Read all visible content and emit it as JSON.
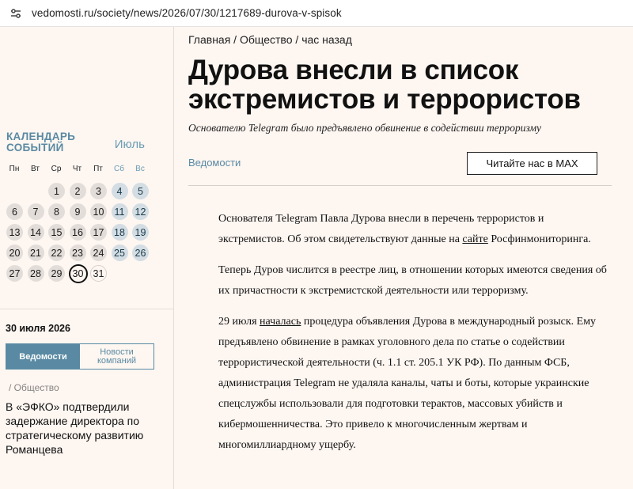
{
  "browser": {
    "url": "vedomosti.ru/society/news/2026/07/30/1217689-durova-v-spisok"
  },
  "breadcrumb": {
    "home": "Главная",
    "sep1": " / ",
    "section": "Общество",
    "sep2": " / ",
    "time": "час назад"
  },
  "article": {
    "headline": "Дурова внесли в список экстремистов и террористов",
    "lead": "Основателю Telegram было предъявлено обвинение в содействии терроризму",
    "source": "Ведомости",
    "max_button": "Читайте нас в MAX",
    "p1_before": "Основателя Telegram Павла Дурова внесли в перечень террористов и экстремистов. Об этом свидетельствуют данные на ",
    "p1_link": "сайте",
    "p1_after": " Росфинмониторинга.",
    "p2": "Теперь Дуров числится в реестре лиц, в отношении которых имеются сведения об их причастности к экстремистской деятельности или терроризму.",
    "p3_before": "29 июля ",
    "p3_link": "началась",
    "p3_after": " процедура объявления Дурова в международный розыск. Ему предъявлено обвинение в рамках уголовного дела по статье о содействии террористической деятельности (ч. 1.1 ст. 205.1 УК РФ). По данным ФСБ, администрация Telegram не удаляла каналы, чаты и боты, которые украинские спецслужбы использовали для подготовки терактов, массовых убийств и кибермошенничества. Это привело к многочисленным жертвам и многомиллиардному ущербу."
  },
  "calendar": {
    "title_line1": "КАЛЕНДАРЬ",
    "title_line2": "СОБЫТИЙ",
    "month": "Июль",
    "weekdays": [
      "Пн",
      "Вт",
      "Ср",
      "Чт",
      "Пт",
      "Сб",
      "Вс"
    ],
    "leading_blanks": 2,
    "days": [
      "1",
      "2",
      "3",
      "4",
      "5",
      "6",
      "7",
      "8",
      "9",
      "10",
      "11",
      "12",
      "13",
      "14",
      "15",
      "16",
      "17",
      "18",
      "19",
      "20",
      "21",
      "22",
      "23",
      "24",
      "25",
      "26",
      "27",
      "28",
      "29",
      "30",
      "31"
    ],
    "today": "30"
  },
  "sidebar": {
    "date": "30 июля 2026",
    "tab_active": "Ведомости",
    "tab_inactive": "Новости компаний",
    "category": "/ Общество",
    "news_title": "В «ЭФКО» подтвердили задержание директора по стратегическому развитию Романцева"
  },
  "colors": {
    "accent": "#5a8aa3",
    "background": "#fdf6f1"
  }
}
